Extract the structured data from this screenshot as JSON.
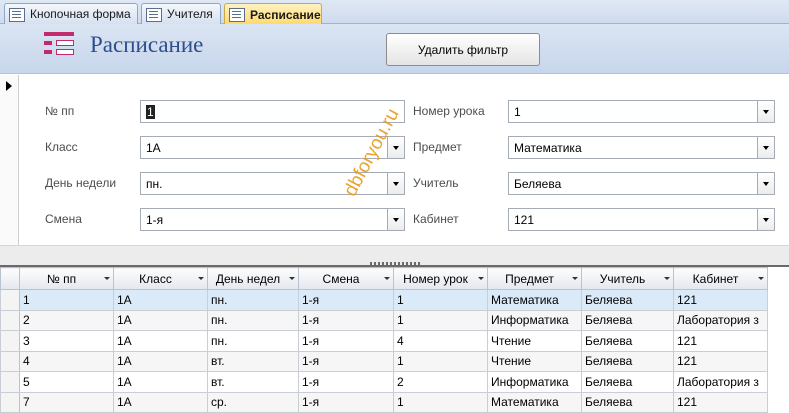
{
  "tabs": [
    {
      "label": "Кнопочная форма"
    },
    {
      "label": "Учителя"
    },
    {
      "label": "Расписание"
    }
  ],
  "header": {
    "title": "Расписание",
    "remove_filter_label": "Удалить фильтр"
  },
  "form": {
    "num_label": "№ пп",
    "num_value": "1",
    "class_label": "Класс",
    "class_value": "1А",
    "day_label": "День недели",
    "day_value": "пн.",
    "shift_label": "Смена",
    "shift_value": "1-я",
    "lesson_label": "Номер урока",
    "lesson_value": "1",
    "subject_label": "Предмет",
    "subject_value": "Математика",
    "teacher_label": "Учитель",
    "teacher_value": "Беляева",
    "room_label": "Кабинет",
    "room_value": "121"
  },
  "watermark": "dbforyou.ru",
  "table": {
    "columns": [
      "№ пп",
      "Класс",
      "День недел",
      "Смена",
      "Номер урок",
      "Предмет",
      "Учитель",
      "Кабинет"
    ],
    "rows": [
      [
        "1",
        "1А",
        "пн.",
        "1-я",
        "1",
        "Математика",
        "Беляева",
        "121"
      ],
      [
        "2",
        "1А",
        "пн.",
        "1-я",
        "1",
        "Информатика",
        "Беляева",
        "Лаборатория з"
      ],
      [
        "3",
        "1А",
        "пн.",
        "1-я",
        "4",
        "Чтение",
        "Беляева",
        "121"
      ],
      [
        "4",
        "1А",
        "вт.",
        "1-я",
        "1",
        "Чтение",
        "Беляева",
        "121"
      ],
      [
        "5",
        "1А",
        "вт.",
        "1-я",
        "2",
        "Информатика",
        "Беляева",
        "Лаборатория з"
      ],
      [
        "7",
        "1А",
        "ср.",
        "1-я",
        "1",
        "Математика",
        "Беляева",
        "121"
      ]
    ]
  }
}
